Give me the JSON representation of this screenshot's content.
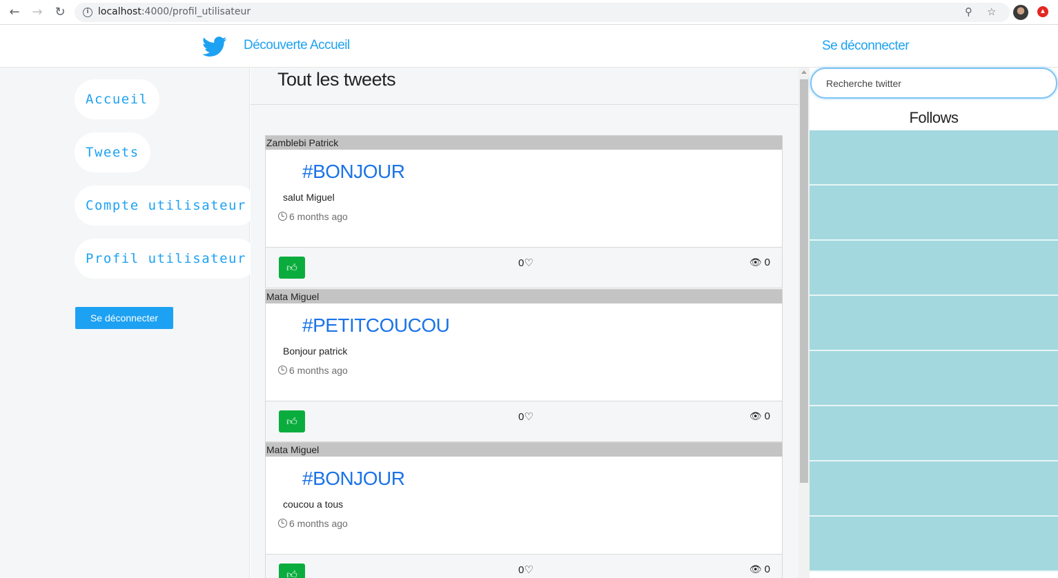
{
  "browser": {
    "url_host": "localhost",
    "url_path": ":4000/profil_utilisateur",
    "icons": [
      "back-icon",
      "forward-icon",
      "reload-icon",
      "info-icon",
      "zoom-icon",
      "star-icon",
      "avatar",
      "extension-icon"
    ]
  },
  "topnav": {
    "discover": "Découverte",
    "home": "Accueil",
    "logout": "Se déconnecter"
  },
  "sidebar": {
    "items": [
      {
        "label": "Accueil"
      },
      {
        "label": "Tweets"
      },
      {
        "label": "Compte utilisateur"
      },
      {
        "label": "Profil utilisateur"
      }
    ],
    "logout_button": "Se déconnecter"
  },
  "main": {
    "title": "Tout les tweets",
    "tweets": [
      {
        "author": "Zamblebi Patrick",
        "hashtag": "#BONJOUR",
        "text": "salut Miguel",
        "time": "6 months ago",
        "likes": "0",
        "views": "0"
      },
      {
        "author": "Mata Miguel",
        "hashtag": "#PETITCOUCOU",
        "text": "Bonjour patrick",
        "time": "6 months ago",
        "likes": "0",
        "views": "0"
      },
      {
        "author": "Mata Miguel",
        "hashtag": "#BONJOUR",
        "text": "coucou a tous",
        "time": "6 months ago",
        "likes": "0",
        "views": "0"
      }
    ]
  },
  "right": {
    "search_placeholder": "Recherche twitter",
    "follows_title": "Follows"
  },
  "colors": {
    "brand": "#1da1f2",
    "like_button": "#0aad3d",
    "follow_cell": "#a3d8de",
    "hashtag": "#1a73e8"
  }
}
